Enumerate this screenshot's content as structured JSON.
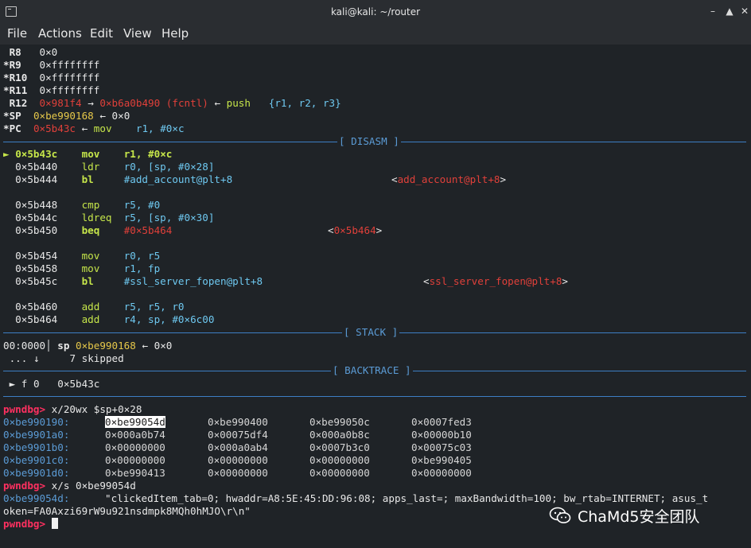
{
  "window": {
    "title": "kali@kali: ~/router"
  },
  "menu": [
    "File",
    "Actions",
    "Edit",
    "View",
    "Help"
  ],
  "registers": [
    {
      "mark": " ",
      "name": "R8",
      "value": "0×0"
    },
    {
      "mark": "*",
      "name": "R9",
      "value": "0×ffffffff"
    },
    {
      "mark": "*",
      "name": "R10",
      "value": "0×ffffffff"
    },
    {
      "mark": "*",
      "name": "R11",
      "value": "0×ffffffff"
    }
  ],
  "r12": {
    "mark": " ",
    "name": "R12",
    "addr": "0×981f4",
    "arrow": "→",
    "target": "0×b6a0b490 (fcntl)",
    "back": "←",
    "instr": "push",
    "args": "{r1, r2, r3}"
  },
  "sp": {
    "mark": "*",
    "name": "SP",
    "value": "0×be990168",
    "arrow": "←",
    "deref": "0×0"
  },
  "pc": {
    "mark": "*",
    "name": "PC",
    "value": "0×5b43c",
    "arrow": "←",
    "instr": "mov",
    "args": "r1, #0×c"
  },
  "sections": {
    "disasm": "[ DISASM ]",
    "stack": "[ STACK ]",
    "backtrace": "[ BACKTRACE ]"
  },
  "disasm": [
    {
      "marker": "►",
      "addr": "0×5b43c",
      "op": "mov",
      "args": "r1, #0×c",
      "target": "",
      "current": true
    },
    {
      "marker": "",
      "addr": "0×5b440",
      "op": "ldr",
      "args": "r0, [sp, #0×28]",
      "target": ""
    },
    {
      "marker": "",
      "addr": "0×5b444",
      "op": "bl",
      "args": "#add_account@plt+8",
      "target": "<add_account@plt+8>"
    },
    {
      "marker": "",
      "addr": "0×5b448",
      "op": "cmp",
      "args": "r5, #0",
      "target": ""
    },
    {
      "marker": "",
      "addr": "0×5b44c",
      "op": "ldreq",
      "args": "r5, [sp, #0×30]",
      "target": ""
    },
    {
      "marker": "",
      "addr": "0×5b450",
      "op": "beq",
      "args": "#0×5b464",
      "target": "<0×5b464>"
    },
    {
      "marker": "",
      "addr": "0×5b454",
      "op": "mov",
      "args": "r0, r5",
      "target": ""
    },
    {
      "marker": "",
      "addr": "0×5b458",
      "op": "mov",
      "args": "r1, fp",
      "target": ""
    },
    {
      "marker": "",
      "addr": "0×5b45c",
      "op": "bl",
      "args": "#ssl_server_fopen@plt+8",
      "target": "<ssl_server_fopen@plt+8>"
    },
    {
      "marker": "",
      "addr": "0×5b460",
      "op": "add",
      "args": "r5, r5, r0",
      "target": ""
    },
    {
      "marker": "",
      "addr": "0×5b464",
      "op": "add",
      "args": "r4, sp, #0×6c00",
      "target": ""
    }
  ],
  "stack": {
    "line1": {
      "offset": "00:0000",
      "reg": "sp",
      "addr": "0×be990168",
      "arrow": "←",
      "value": "0×0"
    },
    "line2": {
      "dots": "...",
      "arrow": "↓",
      "text": "7 skipped"
    }
  },
  "backtrace": {
    "marker": "►",
    "frame": "f 0",
    "addr": "0×5b43c"
  },
  "commands": [
    {
      "prompt": "pwndbg>",
      "text": "x/20wx $sp+0×28"
    },
    {
      "prompt": "pwndbg>",
      "text": "x/s 0×be99054d"
    },
    {
      "prompt": "pwndbg>",
      "text": ""
    }
  ],
  "memdump": [
    {
      "addr": "0×be990190:",
      "w": [
        "0×be99054d",
        "0×be990400",
        "0×be99050c",
        "0×0007fed3"
      ],
      "highlight": 0
    },
    {
      "addr": "0×be9901a0:",
      "w": [
        "0×000a0b74",
        "0×00075df4",
        "0×000a0b8c",
        "0×00000b10"
      ]
    },
    {
      "addr": "0×be9901b0:",
      "w": [
        "0×00000000",
        "0×000a0ab4",
        "0×0007b3c0",
        "0×00075c03"
      ]
    },
    {
      "addr": "0×be9901c0:",
      "w": [
        "0×00000000",
        "0×00000000",
        "0×00000000",
        "0×be990405"
      ]
    },
    {
      "addr": "0×be9901d0:",
      "w": [
        "0×be990413",
        "0×00000000",
        "0×00000000",
        "0×00000000"
      ]
    }
  ],
  "string_result": {
    "addr": "0×be99054d:",
    "line1": "\"clickedItem_tab=0; hwaddr=A8:5E:45:DD:96:08; apps_last=; maxBandwidth=100; bw_rtab=INTERNET; asus_t",
    "line2": "oken=FA0Axzi69rW9u921nsdmpk8MQh0hMJO\\r\\n\""
  },
  "watermark": {
    "icon": "wechat-icon",
    "text": "ChaMd5安全团队"
  },
  "colors": {
    "bg": "#1f2327",
    "accent": "#3d7ec4",
    "prompt": "#ff3060",
    "op": "#c6e64a",
    "addr": "#e0403a"
  }
}
